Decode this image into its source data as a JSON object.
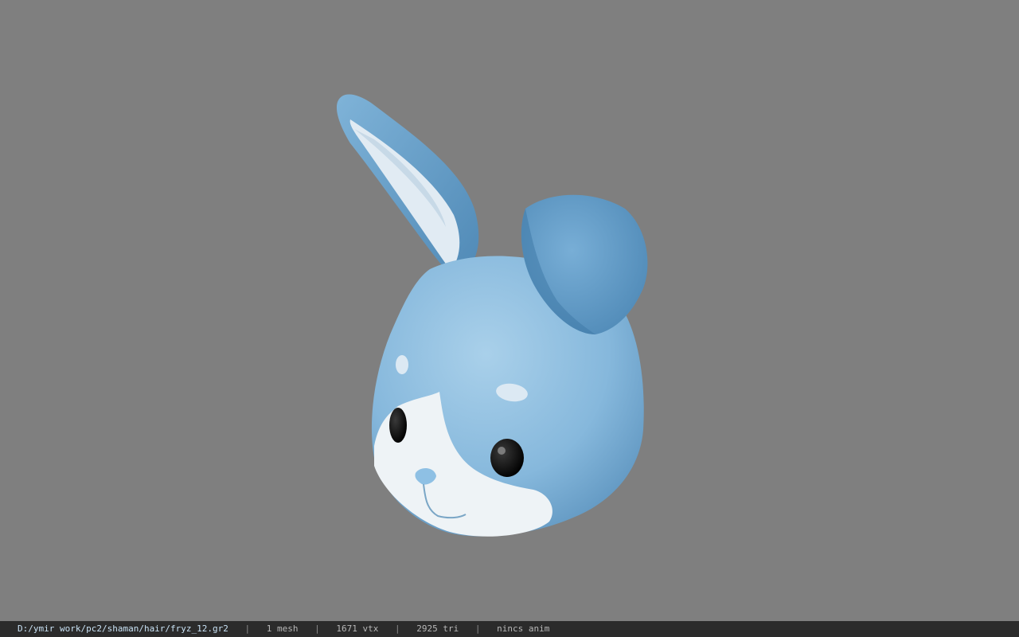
{
  "viewport": {
    "background": "#7f7f7f",
    "model_colors": {
      "fur": "#8fbfe0",
      "fur_dark": "#5d97c0",
      "muzzle": "#eef3f6",
      "inner_ear": "#d8e6f0",
      "eye": "#0b0b0b"
    }
  },
  "status_bar": {
    "file_path": "D:/ymir work/pc2/shaman/hair/fryz_12.gr2",
    "separator": "|",
    "mesh_count": "1 mesh",
    "vertex_count": "1671 vtx",
    "triangle_count": "2925 tri",
    "anim_status": "nincs anim"
  }
}
